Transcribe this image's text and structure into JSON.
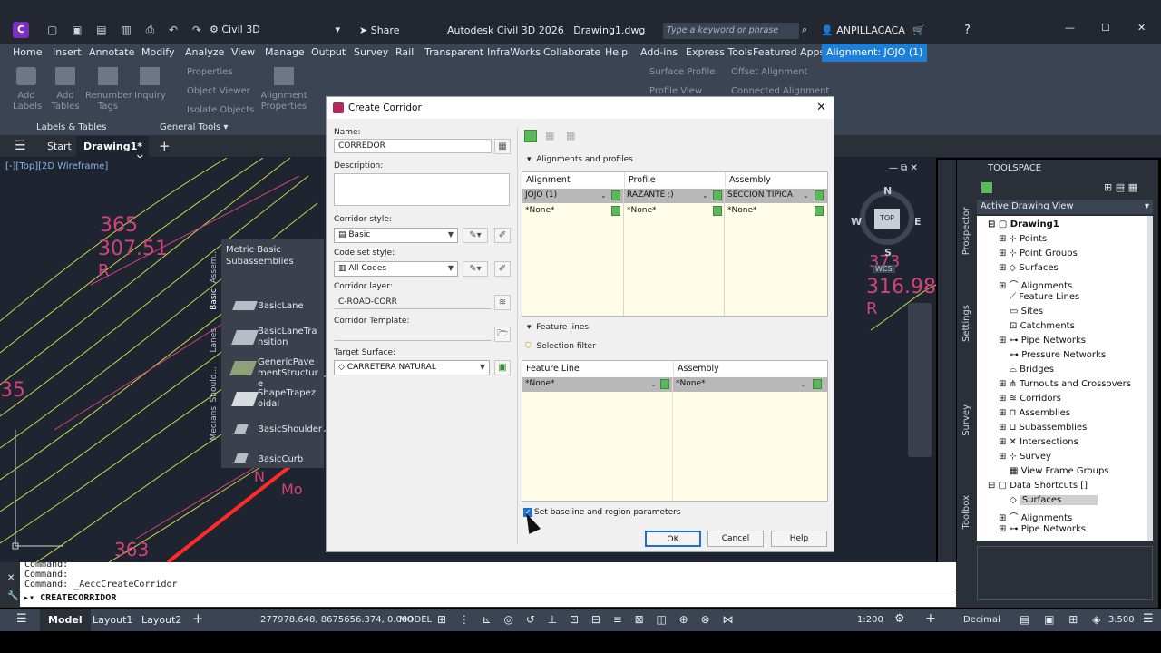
{
  "app": {
    "workspace": "Civil 3D",
    "share": "Share",
    "title": "Autodesk Civil 3D 2026   Drawing1.dwg",
    "search_placeholder": "Type a keyword or phrase",
    "user": "ANPILLACACA"
  },
  "ribbon_tabs": [
    "Home",
    "Insert",
    "Annotate",
    "Modify",
    "Analyze",
    "View",
    "Manage",
    "Output",
    "Survey",
    "Rail",
    "Transparent",
    "InfraWorks",
    "Collaborate",
    "Help",
    "Add-ins",
    "Express Tools",
    "Featured Apps",
    "Alignment: JOJO (1)"
  ],
  "ribbon": {
    "add_labels": "Add Labels",
    "add_tables": "Add Tables",
    "renumber_tags": "Renumber Tags",
    "inquiry": "Inquiry",
    "properties": "Properties",
    "object_viewer": "Object Viewer",
    "isolate_objects": "Isolate Objects",
    "alignment_properties": "Alignment Properties",
    "surface_profile": "Surface Profile",
    "offset_alignment": "Offset Alignment",
    "profile_view": "Profile View",
    "connected_alignment": "Connected Alignment",
    "panel_labels": "Labels & Tables",
    "panel_general": "General Tools"
  },
  "doc_tabs": {
    "start": "Start",
    "drawing": "Drawing1*"
  },
  "viewport": {
    "label": "[-][Top][2D Wireframe]",
    "compass": {
      "n": "N",
      "s": "S",
      "e": "E",
      "w": "W",
      "top": "TOP",
      "wcs": "WCS"
    },
    "texts": [
      "365",
      "307.51",
      "R",
      "35",
      "363",
      "316.98",
      "R",
      "373",
      "N",
      "Mo"
    ]
  },
  "palette": {
    "title": "Metric Basic Subassemblies",
    "tabs": [
      "Assem...",
      "Basic",
      "Lanes",
      "Should...",
      "Medians"
    ],
    "items": [
      "BasicLane",
      "BasicLaneTransition",
      "GenericPavementStructure",
      "ShapeTrapezoidal",
      "BasicShoulder",
      "BasicCurb"
    ]
  },
  "dialog": {
    "title": "Create Corridor",
    "name_label": "Name:",
    "name_value": "CORREDOR",
    "description_label": "Description:",
    "style_label": "Corridor style:",
    "style_value": "Basic",
    "codeset_label": "Code set style:",
    "codeset_value": "All Codes",
    "layer_label": "Corridor layer:",
    "layer_value": "C-ROAD-CORR",
    "template_label": "Corridor Template:",
    "surface_label": "Target Surface:",
    "surface_value": "CARRETERA NATURAL",
    "section_alignments": "Alignments and profiles",
    "col_alignment": "Alignment",
    "col_profile": "Profile",
    "col_assembly": "Assembly",
    "rows": [
      [
        "JOJO (1)",
        "RAZANTE :)",
        "SECCION TIPICA"
      ],
      [
        "*None*",
        "*None*",
        "*None*"
      ]
    ],
    "section_feature": "Feature lines",
    "selection_filter": "Selection filter",
    "col_feature": "Feature Line",
    "col_feature_assembly": "Assembly",
    "feature_rows": [
      [
        "*None*",
        "*None*"
      ]
    ],
    "checkbox_label": "Set baseline and region parameters",
    "ok": "OK",
    "cancel": "Cancel",
    "help": "Help"
  },
  "command": {
    "lines": [
      "Command:",
      "Command:",
      "Command: _AeccCreateCorridor"
    ],
    "input": "CREATECORRIDOR"
  },
  "toolspace": {
    "title": "TOOLSPACE",
    "view": "Active Drawing View",
    "tabs": [
      "Prospector",
      "Settings",
      "Survey",
      "Toolbox"
    ],
    "tree": [
      "Drawing1",
      "Points",
      "Point Groups",
      "Surfaces",
      "Alignments",
      "Feature Lines",
      "Sites",
      "Catchments",
      "Pipe Networks",
      "Pressure Networks",
      "Bridges",
      "Turnouts and Crossovers",
      "Corridors",
      "Assemblies",
      "Subassemblies",
      "Intersections",
      "Survey",
      "View Frame Groups",
      "Data Shortcuts []",
      "Surfaces",
      "Alignments",
      "Pipe Networks"
    ]
  },
  "status": {
    "model": "Model",
    "layout1": "Layout1",
    "layout2": "Layout2",
    "coords": "277978.648, 8675656.374, 0.000",
    "mode": "MODEL",
    "scale": "1:200",
    "units": "Decimal",
    "value": "3.500"
  }
}
